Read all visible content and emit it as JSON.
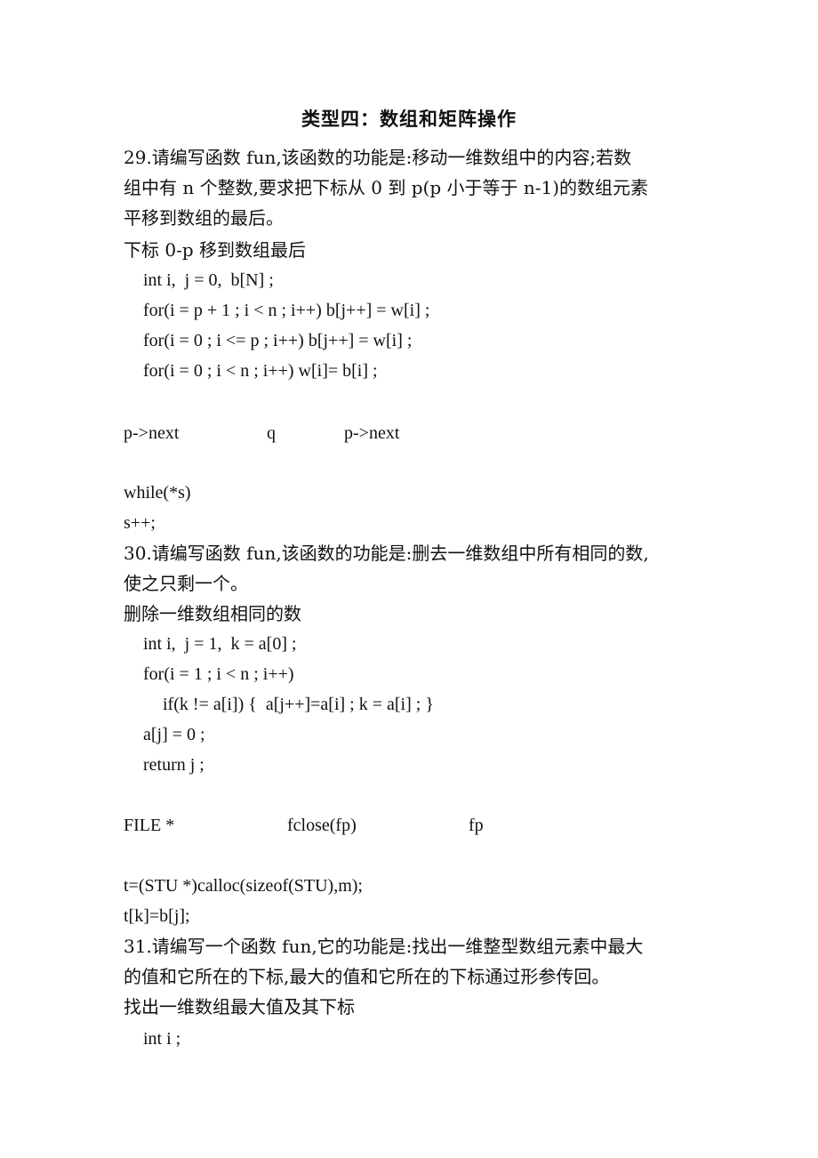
{
  "title": "类型四：数组和矩阵操作",
  "sections": [
    {
      "question": [
        "29.请编写函数 fun,该函数的功能是:移动一维数组中的内容;若数",
        "组中有 n 个整数,要求把下标从 0 到 p(p 小于等于 n-1)的数组元素",
        "平移到数组的最后。"
      ],
      "subtitle": "下标 0-p 移到数组最后",
      "code": [
        "int i,  j = 0,  b[N] ;",
        "for(i = p + 1 ; i < n ; i++) b[j++] = w[i] ;",
        "for(i = 0 ; i <= p ; i++) b[j++] = w[i] ;",
        "for(i = 0 ; i < n ; i++) w[i]= b[i] ;"
      ],
      "blanks": [
        "p->next",
        "q",
        "p->next"
      ],
      "extra": [
        "while(*s)",
        "s++;"
      ]
    },
    {
      "question": [
        "30.请编写函数 fun,该函数的功能是:删去一维数组中所有相同的数,",
        "使之只剩一个。"
      ],
      "subtitle": "删除一维数组相同的数",
      "code": [
        "int i,  j = 1,  k = a[0] ;",
        "for(i = 1 ; i < n ; i++)",
        "if(k != a[i]) {  a[j++]=a[i] ; k = a[i] ; }",
        "a[j] = 0 ;",
        "return j ;"
      ],
      "blanks": [
        "FILE *",
        "fclose(fp)",
        "fp"
      ],
      "extra": [
        "t=(STU *)calloc(sizeof(STU),m);",
        "t[k]=b[j];"
      ]
    },
    {
      "question": [
        "31.请编写一个函数 fun,它的功能是:找出一维整型数组元素中最大",
        "的值和它所在的下标,最大的值和它所在的下标通过形参传回。"
      ],
      "subtitle": "找出一维数组最大值及其下标",
      "code": [
        "int i ;"
      ]
    }
  ]
}
